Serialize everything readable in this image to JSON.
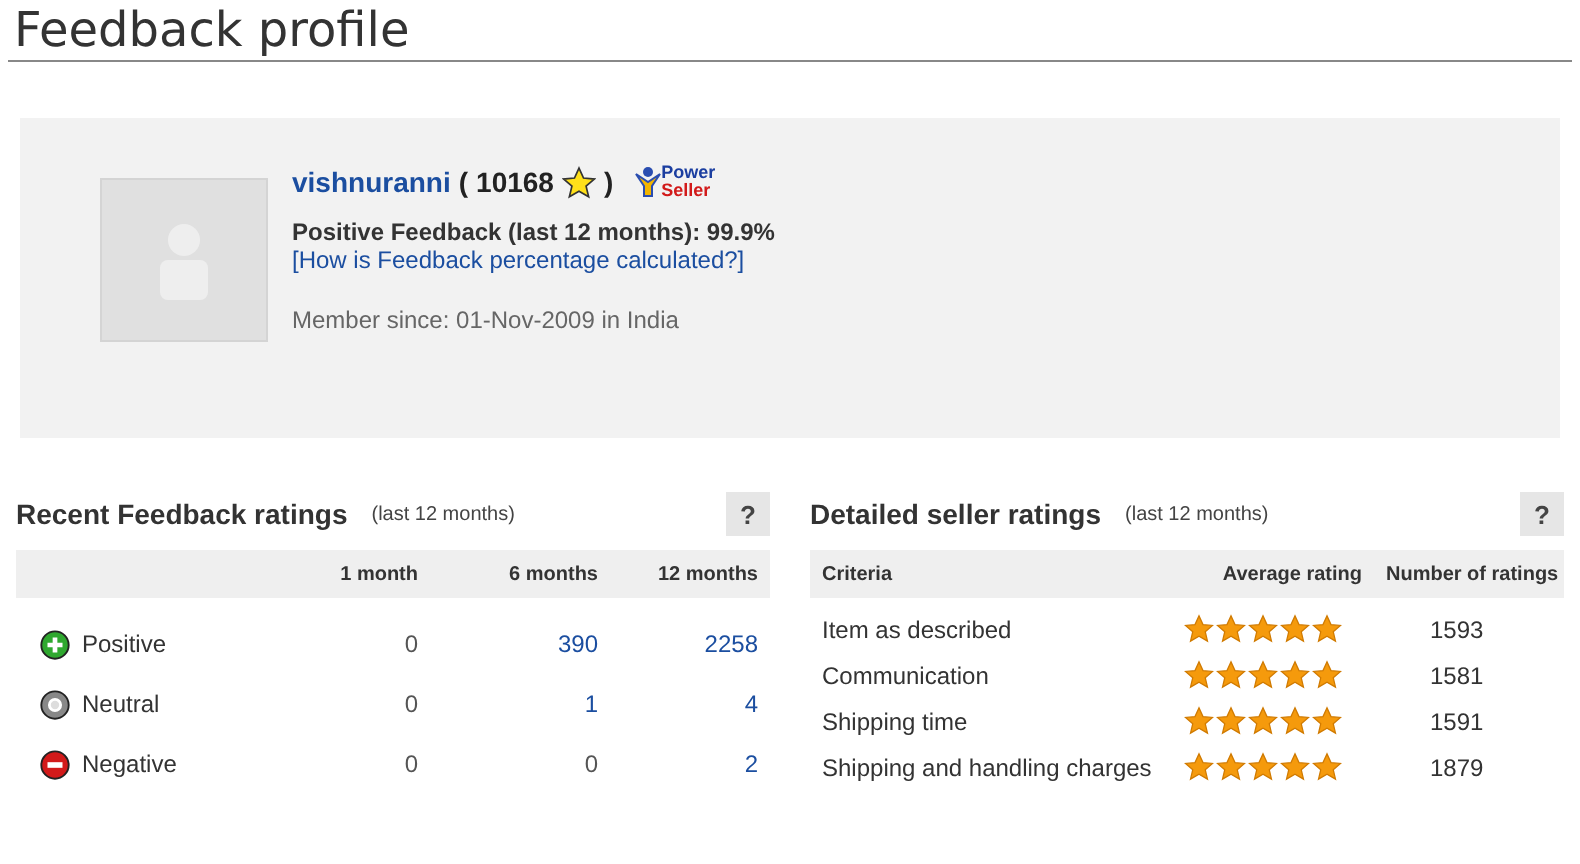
{
  "page_title": "Feedback profile",
  "profile": {
    "username": "vishnuranni",
    "score_open": "(",
    "score": "10168",
    "score_close": ")",
    "badge_top": "Power",
    "badge_bottom": "Seller",
    "positive": "Positive Feedback (last 12 months): 99.9%",
    "help_link": "[How is Feedback percentage calculated?]",
    "member_since": "Member since: 01-Nov-2009 in India"
  },
  "recent": {
    "title": "Recent Feedback ratings",
    "period": "(last 12 months)",
    "help": "?",
    "columns": [
      "1 month",
      "6 months",
      "12 months"
    ],
    "rows": [
      {
        "kind": "positive",
        "label": "Positive",
        "cells": [
          {
            "text": "0",
            "linked": false
          },
          {
            "text": "390",
            "linked": true
          },
          {
            "text": "2258",
            "linked": true
          }
        ]
      },
      {
        "kind": "neutral",
        "label": "Neutral",
        "cells": [
          {
            "text": "0",
            "linked": false
          },
          {
            "text": "1",
            "linked": true
          },
          {
            "text": "4",
            "linked": true
          }
        ]
      },
      {
        "kind": "negative",
        "label": "Negative",
        "cells": [
          {
            "text": "0",
            "linked": false
          },
          {
            "text": "0",
            "linked": false
          },
          {
            "text": "2",
            "linked": true
          }
        ]
      }
    ]
  },
  "detailed": {
    "title": "Detailed seller ratings",
    "period": "(last 12 months)",
    "help": "?",
    "columns": [
      "Criteria",
      "Average rating",
      "Number of ratings"
    ],
    "rows": [
      {
        "criteria": "Item as described",
        "stars": 5,
        "count": "1593"
      },
      {
        "criteria": "Communication",
        "stars": 5,
        "count": "1581"
      },
      {
        "criteria": "Shipping time",
        "stars": 5,
        "count": "1591"
      },
      {
        "criteria": "Shipping and handling charges",
        "stars": 5,
        "count": "1879"
      }
    ]
  }
}
